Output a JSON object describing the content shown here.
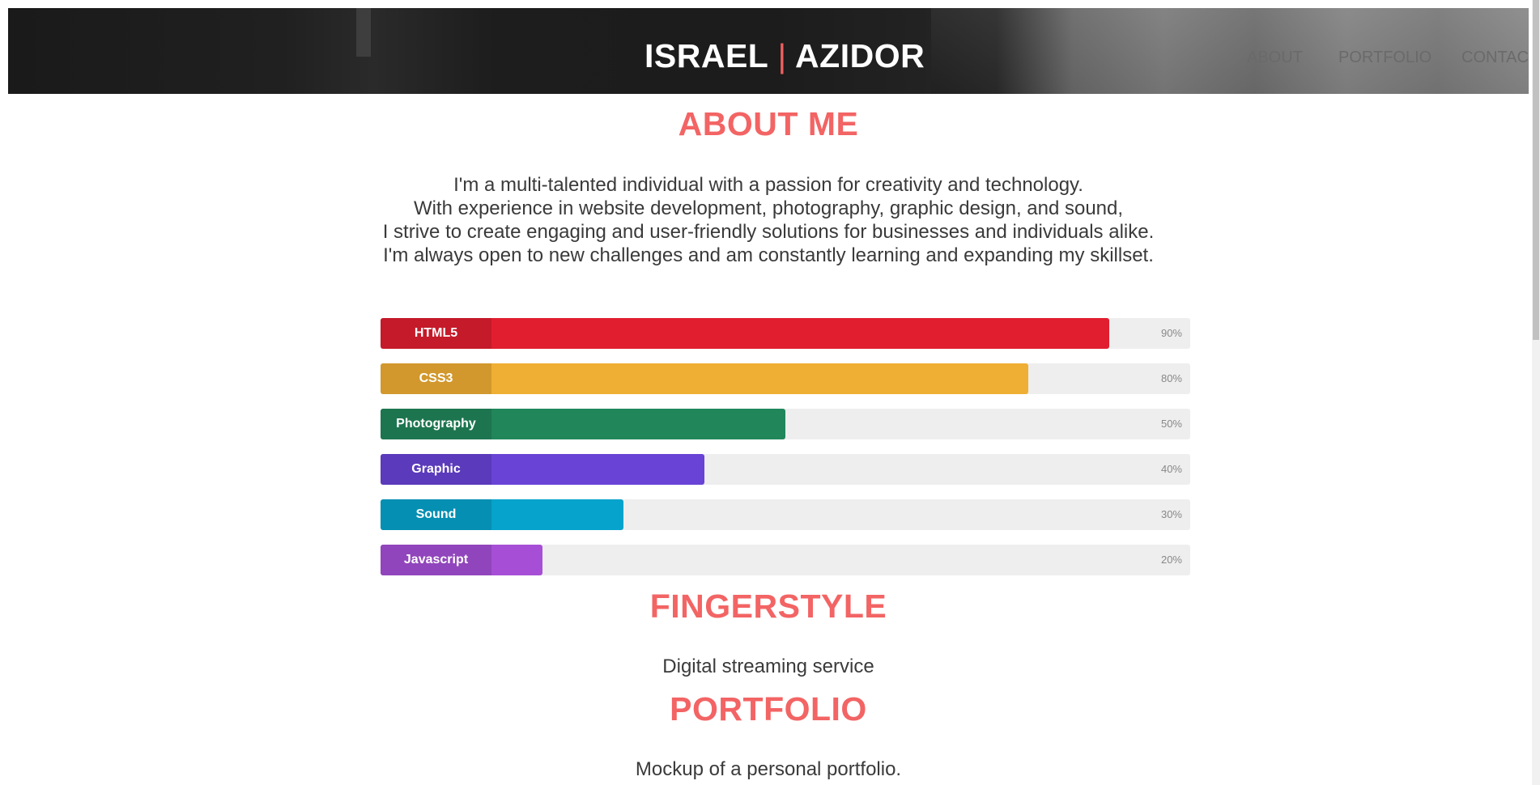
{
  "header": {
    "brand_first": "ISRAEL",
    "brand_sep": "|",
    "brand_last": "AZIDOR",
    "nav": {
      "about": "ABOUT",
      "portfolio": "PORTFOLIO",
      "contact": "CONTACT"
    }
  },
  "about": {
    "title": "ABOUT ME",
    "lines": [
      "I'm a multi-talented individual with a passion for creativity and technology.",
      "With experience in website development, photography, graphic design, and sound,",
      "I strive to create engaging and user-friendly solutions for businesses and individuals alike.",
      "I'm always open to new challenges and am constantly learning and expanding my skillset."
    ]
  },
  "skills": [
    {
      "label": "HTML5",
      "percent_text": "90%",
      "level": 0.9,
      "color": "#e01e2f"
    },
    {
      "label": "CSS3",
      "percent_text": "80%",
      "level": 0.8,
      "color": "#efae34"
    },
    {
      "label": "Photography",
      "percent_text": "50%",
      "level": 0.5,
      "color": "#21865a"
    },
    {
      "label": "Graphic",
      "percent_text": "40%",
      "level": 0.4,
      "color": "#6843d5"
    },
    {
      "label": "Sound",
      "percent_text": "30%",
      "level": 0.3,
      "color": "#06a3cc"
    },
    {
      "label": "Javascript",
      "percent_text": "20%",
      "level": 0.2,
      "color": "#a64fd6"
    }
  ],
  "fingerstyle": {
    "title": "FINGERSTYLE",
    "description": "Digital streaming service"
  },
  "portfolio": {
    "title": "PORTFOLIO",
    "description": "Mockup of a personal portfolio."
  },
  "colors": {
    "accent": "#f36464",
    "text": "#3a3a3a"
  }
}
